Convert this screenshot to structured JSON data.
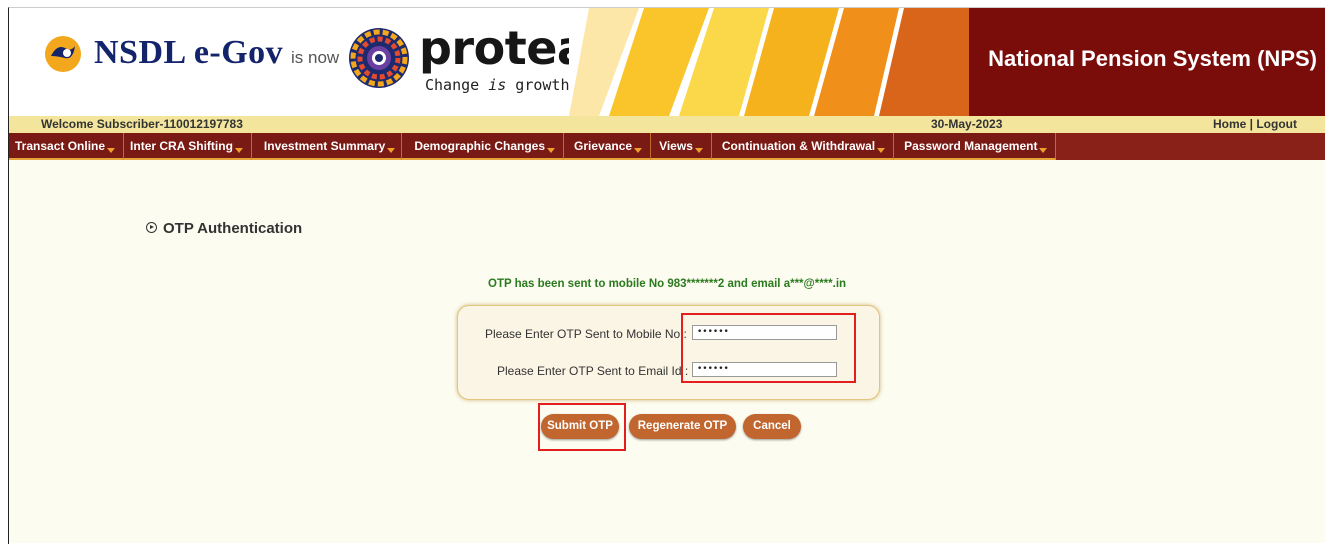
{
  "header": {
    "nsdl_brand": "NSDL e-Gov",
    "is_now": "is now",
    "protean_brand": "protean",
    "tagline_pre": "Change ",
    "tagline_em": "is",
    "tagline_post": " growth",
    "system_title": "National Pension System (NPS)"
  },
  "welcome_bar": {
    "welcome": "Welcome Subscriber-110012197783",
    "date": "30-May-2023",
    "home": "Home",
    "separator": " | ",
    "logout": "Logout"
  },
  "nav": {
    "items": [
      {
        "label": "Transact Online"
      },
      {
        "label": "Inter CRA Shifting"
      },
      {
        "label": "Investment Summary"
      },
      {
        "label": "Demographic Changes"
      },
      {
        "label": "Grievance"
      },
      {
        "label": "Views"
      },
      {
        "label": "Continuation & Withdrawal"
      },
      {
        "label": "Password Management"
      }
    ]
  },
  "main": {
    "section_title": "OTP Authentication",
    "otp_message": "OTP has been sent to mobile No 983*******2 and email a***@****.in",
    "mobile_label": "Please Enter OTP Sent to Mobile No :",
    "email_label": "Please Enter OTP Sent to Email Id :",
    "mobile_value": "••••••",
    "email_value": "••••••",
    "buttons": {
      "submit": "Submit OTP",
      "regenerate": "Regenerate OTP",
      "cancel": "Cancel"
    }
  },
  "colors": {
    "nav_bg": "#7a1a14",
    "nps_bg": "#7a0c0a",
    "welcome_bg": "#f3e59c",
    "button": "#c0662e",
    "message_green": "#2a7a1e",
    "highlight_red": "#e21e1e"
  }
}
